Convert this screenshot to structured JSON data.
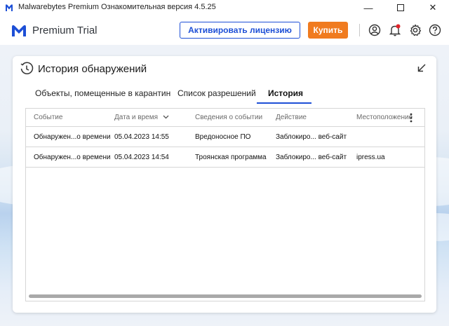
{
  "window": {
    "title": "Malwarebytes Premium Ознакомительная версия  4.5.25",
    "minimize_glyph": "—",
    "maximize_glyph": "☐",
    "close_glyph": "✕"
  },
  "header": {
    "product_name": "Premium Trial",
    "activate_label": "Активировать лицензию",
    "buy_label": "Купить",
    "icons": [
      "account-icon",
      "notification-bell-icon",
      "settings-gear-icon",
      "help-icon"
    ],
    "colors": {
      "accent_blue": "#1d4fd6",
      "buy_orange": "#f07b1f",
      "notification_red": "#e0242a"
    }
  },
  "panel": {
    "title": "История обнаружений",
    "tabs": [
      {
        "label": "Объекты, помещенные в карантин",
        "active": false
      },
      {
        "label": "Список разрешений",
        "active": false
      },
      {
        "label": "История",
        "active": true
      }
    ]
  },
  "table": {
    "columns": [
      "Событие",
      "Дата и время",
      "Сведения о событии",
      "Действие",
      "Местоположение"
    ],
    "sort_indicator": "⌄",
    "rows": [
      [
        "Обнаружен...о времени",
        "05.04.2023 14:55",
        "Вредоносное ПО",
        "Заблокиро... веб-сайт",
        ""
      ],
      [
        "Обнаружен...о времени",
        "05.04.2023 14:54",
        "Троянская программа",
        "Заблокиро... веб-сайт",
        "ipress.ua"
      ]
    ]
  }
}
